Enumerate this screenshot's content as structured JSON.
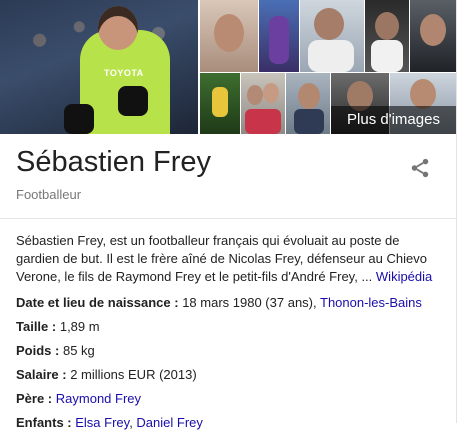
{
  "images": {
    "more_label": "Plus d'images",
    "hero_sponsor": "TOYOTA"
  },
  "entity": {
    "name": "Sébastien Frey",
    "type": "Footballeur"
  },
  "description": {
    "text": "Sébastien Frey, est un footballeur français qui évoluait au poste de gardien de but. Il est le frère aîné de Nicolas Frey, défenseur au Chievo Verone, le fils de Raymond Frey et le petit-fils d'André Frey, ...",
    "source": "Wikipédia"
  },
  "facts": [
    {
      "label": "Date et lieu de naissance :",
      "value": "18 mars 1980 (37 ans),",
      "link": "Thonon-les-Bains"
    },
    {
      "label": "Taille :",
      "value": "1,89 m"
    },
    {
      "label": "Poids :",
      "value": "85 kg"
    },
    {
      "label": "Salaire :",
      "value": "2 millions EUR (2013)"
    },
    {
      "label": "Père :",
      "link": "Raymond Frey"
    },
    {
      "label": "Enfants :",
      "link": "Elsa Frey",
      "link2": "Daniel Frey"
    }
  ],
  "colors": {
    "link": "#1a0dab",
    "muted": "#777777",
    "jersey": "#b7e24a"
  }
}
